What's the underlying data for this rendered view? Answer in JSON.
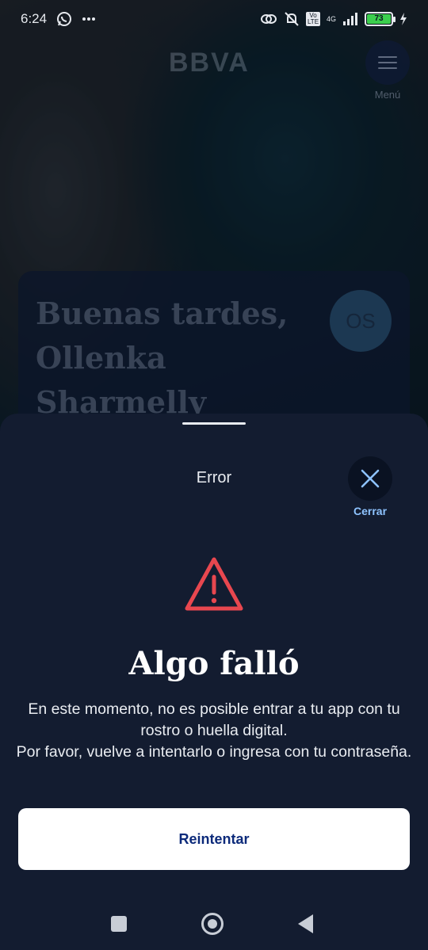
{
  "status_bar": {
    "time": "6:24",
    "battery_level": "73",
    "network": "4G",
    "volte": "Vo LTE",
    "icons": [
      "whatsapp-icon",
      "more-dots-icon",
      "link-icon",
      "mute-icon",
      "signal-icon",
      "battery-icon",
      "charging-icon"
    ]
  },
  "header": {
    "logo_text": "BBVA",
    "menu_label": "Menú"
  },
  "greeting": {
    "text_line1": "Buenas tardes,",
    "text_line2": "Ollenka",
    "text_line3": "Sharmelly",
    "avatar_initials": "OS"
  },
  "sheet": {
    "title": "Error",
    "close_label": "Cerrar",
    "heading": "Algo falló",
    "body_line1": "En este momento, no es posible entrar a tu app con tu rostro o huella digital.",
    "body_line2": "Por favor, vuelve a intentarlo o ingresa con tu contraseña.",
    "retry_label": "Reintentar"
  },
  "colors": {
    "sheet_bg": "#131c30",
    "accent_link": "#8ec3ff",
    "warning_red": "#e8474f",
    "primary_button_text": "#0c2a7a"
  }
}
